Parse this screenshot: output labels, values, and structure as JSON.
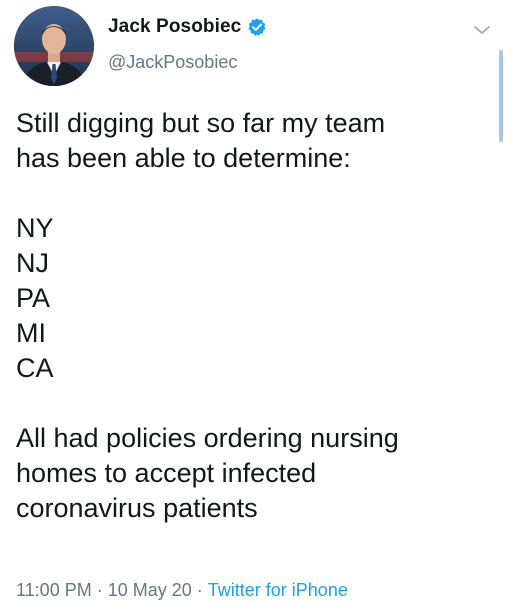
{
  "author": {
    "display_name": "Jack Posobiec",
    "handle": "@JackPosobiec",
    "verified": true,
    "avatar_icon": "profile-photo"
  },
  "tweet": {
    "intro_lines": [
      "Still digging but so far my team",
      "has been able to determine:"
    ],
    "states": [
      "NY",
      "NJ",
      "PA",
      "MI",
      "CA"
    ],
    "closing_lines": [
      "All had policies ordering nursing",
      "homes to accept infected",
      "coronavirus patients"
    ]
  },
  "meta": {
    "time": "11:00 PM",
    "date": "10 May 20",
    "separator": "·",
    "source": "Twitter for iPhone"
  },
  "colors": {
    "text": "#14171a",
    "secondary": "#657786",
    "accent": "#1da1f2"
  }
}
